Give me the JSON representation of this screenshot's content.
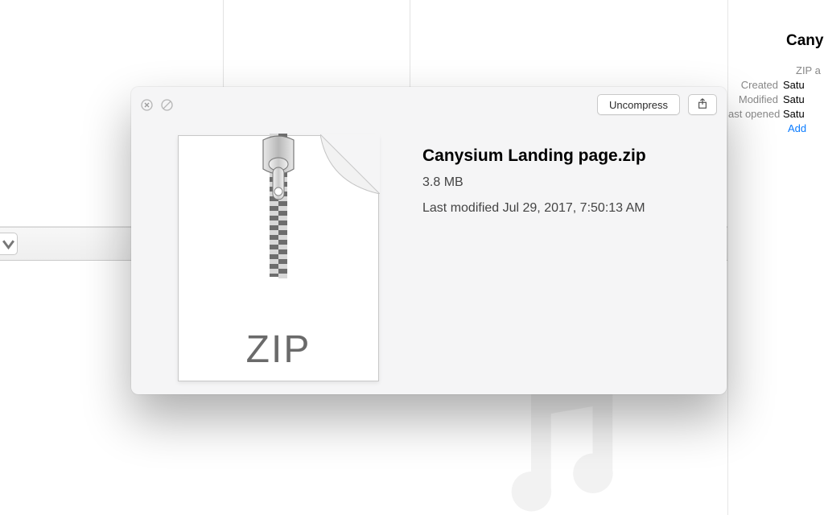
{
  "panel": {
    "uncompress_label": "Uncompress",
    "file_name": "Canysium Landing page.zip",
    "file_size": "3.8 MB",
    "last_modified": "Last modified Jul 29, 2017, 7:50:13 AM",
    "zip_badge": "ZIP"
  },
  "inspector": {
    "title": "Canys",
    "kind": "ZIP a",
    "created_label": "Created",
    "created_value": "Satu",
    "modified_label": "Modified",
    "modified_value": "Satu",
    "opened_label": "ast opened",
    "opened_value": "Satu",
    "add_tags": "Add "
  }
}
